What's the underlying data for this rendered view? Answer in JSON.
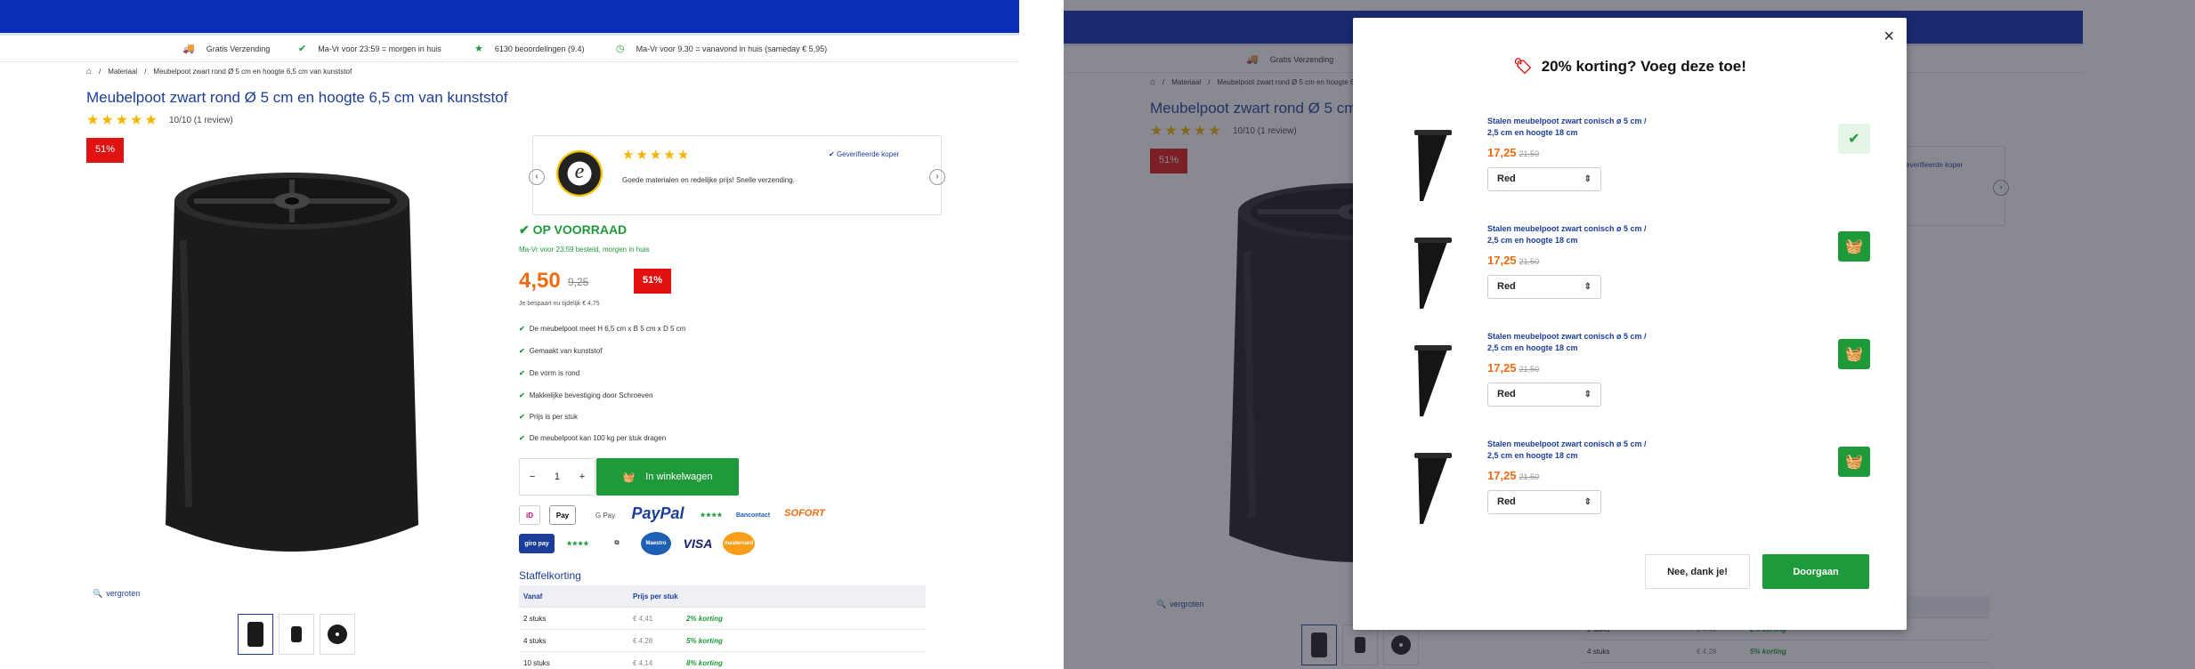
{
  "product": {
    "usp": [
      {
        "icon": "truck-icon",
        "text": "Gratis Verzending"
      },
      {
        "icon": "check-icon",
        "text": "Ma-Vr voor 23:59 = morgen in huis"
      },
      {
        "icon": "star-icon",
        "text": "6130 beoordelingen (9.4)"
      },
      {
        "icon": "clock-icon",
        "text": "Ma-Vr voor 9.30 = vanavond in huis (sameday € 5,95)"
      }
    ],
    "breadcrumb": [
      "Materiaal",
      "Meubelpoot zwart rond Ø 5 cm en hoogte 6,5 cm van kunststof"
    ],
    "title": "Meubelpoot zwart rond Ø 5 cm en hoogte 6,5 cm van kunststof",
    "stars": "★★★★★",
    "rating": "10/10 (1 review)",
    "discount_badge": "51%",
    "zoom_label": "vergroten",
    "review": {
      "stars": "★★★★★",
      "verified": "Geverifieerde koper",
      "text": "Goede materialen en redelijke prijs! Snelle verzending.",
      "logo_letter": "e"
    },
    "stock": "OP VOORRAAD",
    "stock_sub": "Ma-Vr voor 23:59 besteld, morgen in huis",
    "price": "4,50",
    "price_old": "9,25",
    "savings": "Je bespaart nu tijdelijk € 4,75",
    "features": [
      "De meubelpoot meet H 6,5 cm x B 5 cm x D 5 cm",
      "Gemaakt van kunststof",
      "De vorm is rond",
      "Makkelijke bevestiging door Schroeven",
      "Prijs is per stuk",
      "De meubelpoot kan 100 kg per stuk dragen"
    ],
    "qty_minus": "−",
    "qty": "1",
    "qty_plus": "+",
    "cart_label": "In winkelwagen",
    "payments": {
      "ideal": "iD",
      "applepay": "Pay",
      "gpay": "G Pay",
      "paypal": "PayPal",
      "bancontact": "Bancontact",
      "sofort": "SOFORT",
      "giropay": "giro pay",
      "maestro": "Maestro",
      "visa": "VISA",
      "mastercard": "mastercard"
    },
    "staffel_title": "Staffelkorting",
    "staffel_head": [
      "Vanaf",
      "Prijs per stuk"
    ],
    "staffel_rows": [
      {
        "qty": "2 stuks",
        "price": "€ 4,41",
        "disc": "2% korting"
      },
      {
        "qty": "4 stuks",
        "price": "€ 4,28",
        "disc": "5% korting"
      },
      {
        "qty": "10 stuks",
        "price": "€ 4,14",
        "disc": "8% korting"
      }
    ]
  },
  "modal": {
    "title": "20% korting? Voeg deze toe!",
    "close": "×",
    "items": [
      {
        "name": "Stalen meubelpoot zwart conisch ø 5 cm / 2,5 cm en hoogte 18 cm",
        "price": "17,25",
        "old": "21,50",
        "color": "Red",
        "added": true
      },
      {
        "name": "Stalen meubelpoot zwart conisch ø 5 cm / 2,5 cm en hoogte 18 cm",
        "price": "17,25",
        "old": "21,50",
        "color": "Red",
        "added": false
      },
      {
        "name": "Stalen meubelpoot zwart conisch ø 5 cm / 2,5 cm en hoogte 18 cm",
        "price": "17,25",
        "old": "21,50",
        "color": "Red",
        "added": false
      },
      {
        "name": "Stalen meubelpoot zwart conisch ø 5 cm / 2,5 cm en hoogte 18 cm",
        "price": "17,25",
        "old": "21,50",
        "color": "Red",
        "added": false
      }
    ],
    "decline": "Nee, dank je!",
    "continue": "Doorgaan"
  }
}
